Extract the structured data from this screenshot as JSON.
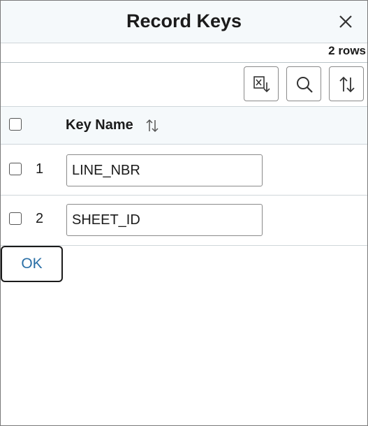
{
  "dialog": {
    "title": "Record Keys",
    "row_count": "2 rows"
  },
  "toolbar": {
    "buttons": [
      {
        "name": "download-to-excel",
        "icon": "excel-download-icon"
      },
      {
        "name": "find",
        "icon": "search-icon"
      },
      {
        "name": "sort",
        "icon": "sort-icon"
      }
    ]
  },
  "grid": {
    "column_header": "Key Name",
    "rows": [
      {
        "number": "1",
        "key_name": "LINE_NBR"
      },
      {
        "number": "2",
        "key_name": "SHEET_ID"
      }
    ]
  },
  "footer": {
    "ok_label": "OK"
  },
  "colors": {
    "header_bg": "#f5f9fb",
    "link_blue": "#2a6fa6",
    "border": "#8a8a8a"
  }
}
